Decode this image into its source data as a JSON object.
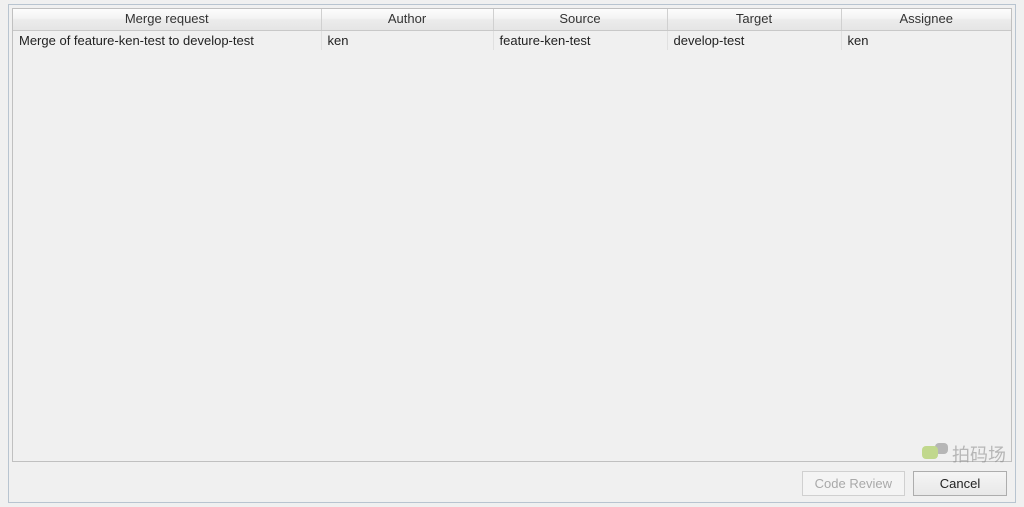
{
  "table": {
    "headers": {
      "merge_request": "Merge request",
      "author": "Author",
      "source": "Source",
      "target": "Target",
      "assignee": "Assignee"
    },
    "rows": [
      {
        "merge_request": "Merge of feature-ken-test to develop-test",
        "author": "ken",
        "source": "feature-ken-test",
        "target": "develop-test",
        "assignee": "ken"
      }
    ]
  },
  "buttons": {
    "code_review": "Code Review",
    "cancel": "Cancel"
  },
  "watermark": {
    "text": "拍码场"
  }
}
